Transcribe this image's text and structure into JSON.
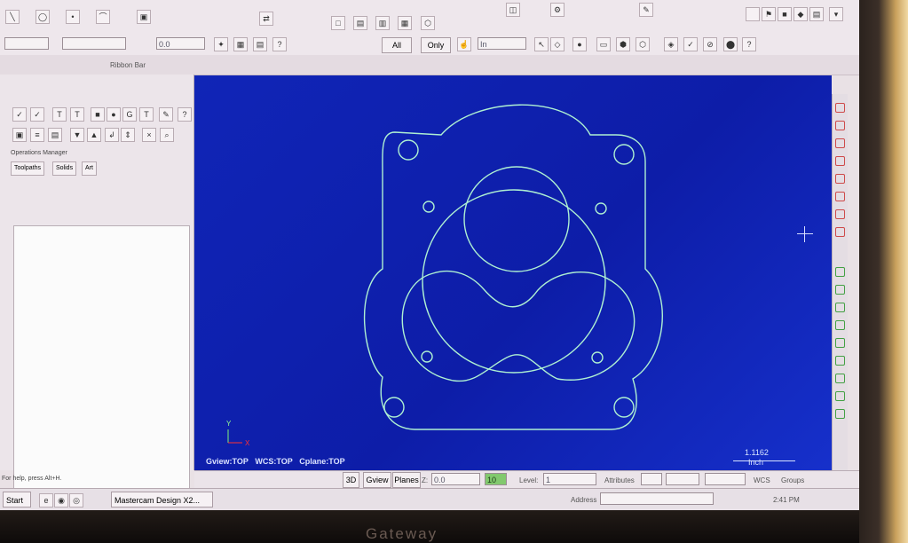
{
  "ribbon": {
    "label": "Ribbon Bar",
    "z_value": "0.0",
    "all_label": "All",
    "only_label": "Only",
    "mask_value": "In"
  },
  "ops_manager": {
    "title": "Operations Manager",
    "tabs": [
      "Toolpaths",
      "Solids",
      "Art"
    ]
  },
  "viewport": {
    "gview": "Gview:TOP",
    "wcs": "WCS:TOP",
    "cplane": "Cplane:TOP",
    "axis_y": "Y",
    "axis_x": "X",
    "scale_value": "1.1162",
    "scale_unit": "Inch"
  },
  "status": {
    "help": "For help, press Alt+H.",
    "mode_3d": "3D",
    "gview": "Gview",
    "planes": "Planes",
    "z_label": "Z:",
    "z_value": "0.0",
    "level_count": "10",
    "level_label": "Level:",
    "level_value": "1",
    "attributes": "Attributes",
    "wcs": "WCS",
    "groups": "Groups"
  },
  "taskbar": {
    "start": "Start",
    "app": "Mastercam Design X2...",
    "address_label": "Address",
    "clock": "2:41 PM"
  },
  "brand": "Gateway",
  "colors": {
    "viewport_blue": "#1127b3",
    "geometry": "#aef0d2",
    "highlight_red": "#ff3030"
  }
}
